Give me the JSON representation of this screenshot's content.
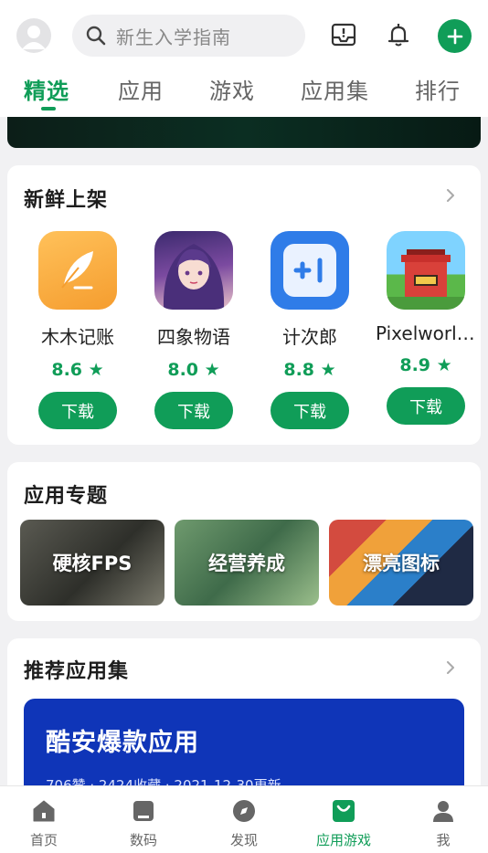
{
  "search": {
    "placeholder": "新生入学指南"
  },
  "tabs": [
    {
      "label": "精选",
      "active": true
    },
    {
      "label": "应用",
      "active": false
    },
    {
      "label": "游戏",
      "active": false
    },
    {
      "label": "应用集",
      "active": false
    },
    {
      "label": "排行",
      "active": false
    }
  ],
  "new_arrivals": {
    "title": "新鲜上架",
    "apps": [
      {
        "name": "木木记账",
        "rating": "8.6 ★",
        "button": "下载",
        "icon": "feather-icon"
      },
      {
        "name": "四象物语",
        "rating": "8.0 ★",
        "button": "下载",
        "icon": "character-portrait-icon"
      },
      {
        "name": "计次郎",
        "rating": "8.8 ★",
        "button": "下载",
        "icon": "plus-one-icon"
      },
      {
        "name": "Pixelworld ...",
        "rating": "8.9 ★",
        "button": "下载",
        "icon": "pixel-temple-icon"
      }
    ]
  },
  "topics": {
    "title": "应用专题",
    "items": [
      {
        "label": "硬核FPS"
      },
      {
        "label": "经营养成"
      },
      {
        "label": "漂亮图标"
      }
    ]
  },
  "collections": {
    "title": "推荐应用集",
    "featured": {
      "title": "酷安爆款应用",
      "meta": "706赞 · 2424收藏 · 2021-12-30更新"
    }
  },
  "bottom_nav": [
    {
      "label": "首页",
      "icon": "home-icon",
      "active": false
    },
    {
      "label": "数码",
      "icon": "digital-icon",
      "active": false
    },
    {
      "label": "发现",
      "icon": "compass-icon",
      "active": false
    },
    {
      "label": "应用游戏",
      "icon": "app-bag-icon",
      "active": true
    },
    {
      "label": "我",
      "icon": "user-icon",
      "active": false
    }
  ],
  "colors": {
    "accent": "#109d58",
    "collection_bg": "#0f35b8"
  }
}
